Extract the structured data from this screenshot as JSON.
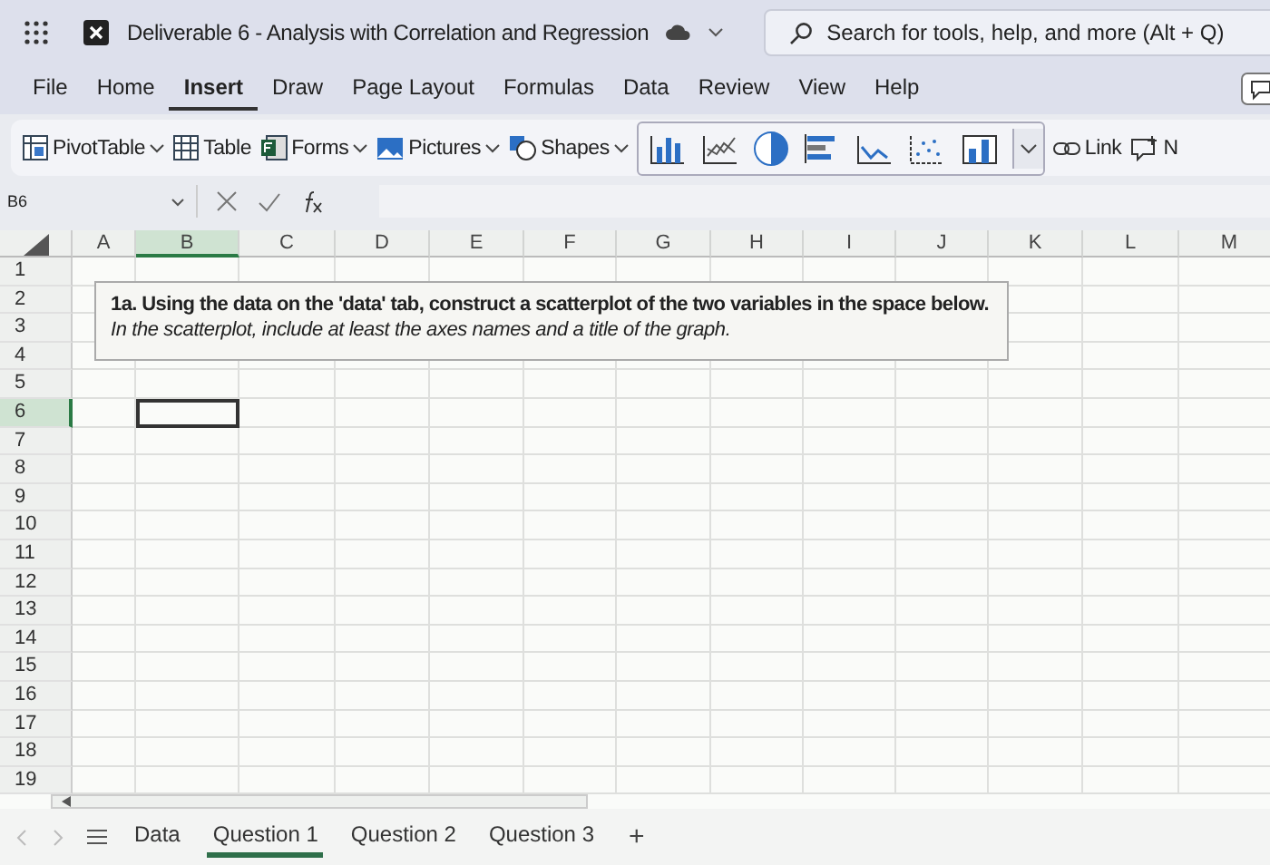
{
  "window": {
    "title": "Deliverable 6 - Analysis with Correlation and Regression"
  },
  "search": {
    "placeholder": "Search for tools, help, and more (Alt + Q)"
  },
  "menu_tabs": [
    {
      "label": "File",
      "selected": false
    },
    {
      "label": "Home",
      "selected": false
    },
    {
      "label": "Insert",
      "selected": true
    },
    {
      "label": "Draw",
      "selected": false
    },
    {
      "label": "Page Layout",
      "selected": false
    },
    {
      "label": "Formulas",
      "selected": false
    },
    {
      "label": "Data",
      "selected": false
    },
    {
      "label": "Review",
      "selected": false
    },
    {
      "label": "View",
      "selected": false
    },
    {
      "label": "Help",
      "selected": false
    }
  ],
  "ribbon": [
    {
      "label": "PivotTable",
      "dropdown": true
    },
    {
      "label": "Table",
      "dropdown": false
    },
    {
      "label": "Forms",
      "dropdown": true
    },
    {
      "label": "Pictures",
      "dropdown": true
    },
    {
      "label": "Shapes",
      "dropdown": true
    }
  ],
  "ribbon_end": [
    {
      "label": "Link"
    },
    {
      "label": "N"
    }
  ],
  "formula_bar": {
    "name_box": "B6"
  },
  "columns": [
    {
      "label": "A",
      "selected": false
    },
    {
      "label": "B",
      "selected": true
    },
    {
      "label": "C",
      "selected": false
    },
    {
      "label": "D",
      "selected": false
    },
    {
      "label": "E",
      "selected": false
    },
    {
      "label": "F",
      "selected": false
    },
    {
      "label": "G",
      "selected": false
    },
    {
      "label": "H",
      "selected": false
    },
    {
      "label": "I",
      "selected": false
    },
    {
      "label": "J",
      "selected": false
    },
    {
      "label": "K",
      "selected": false
    },
    {
      "label": "L",
      "selected": false
    },
    {
      "label": "M",
      "selected": false
    }
  ],
  "rows": [
    {
      "label": "1",
      "selected": false
    },
    {
      "label": "2",
      "selected": false
    },
    {
      "label": "3",
      "selected": false
    },
    {
      "label": "4",
      "selected": false
    },
    {
      "label": "5",
      "selected": false
    },
    {
      "label": "6",
      "selected": true
    },
    {
      "label": "7",
      "selected": false
    },
    {
      "label": "8",
      "selected": false
    },
    {
      "label": "9",
      "selected": false
    },
    {
      "label": "10",
      "selected": false
    },
    {
      "label": "11",
      "selected": false
    },
    {
      "label": "12",
      "selected": false
    },
    {
      "label": "13",
      "selected": false
    },
    {
      "label": "14",
      "selected": false
    },
    {
      "label": "15",
      "selected": false
    },
    {
      "label": "16",
      "selected": false
    },
    {
      "label": "17",
      "selected": false
    },
    {
      "label": "18",
      "selected": false
    },
    {
      "label": "19",
      "selected": false
    }
  ],
  "text_box": {
    "line_1": "1a. Using the data on the 'data' tab, construct a scatterplot of the two variables in the space below.",
    "line_2": "In the scatterplot, include at least the axes names and a title of the graph."
  },
  "sheet_tabs": [
    {
      "label": "Data",
      "selected": false
    },
    {
      "label": "Question 1",
      "selected": true
    },
    {
      "label": "Question 2",
      "selected": false
    },
    {
      "label": "Question 3",
      "selected": false
    }
  ],
  "add_sheet": "+"
}
